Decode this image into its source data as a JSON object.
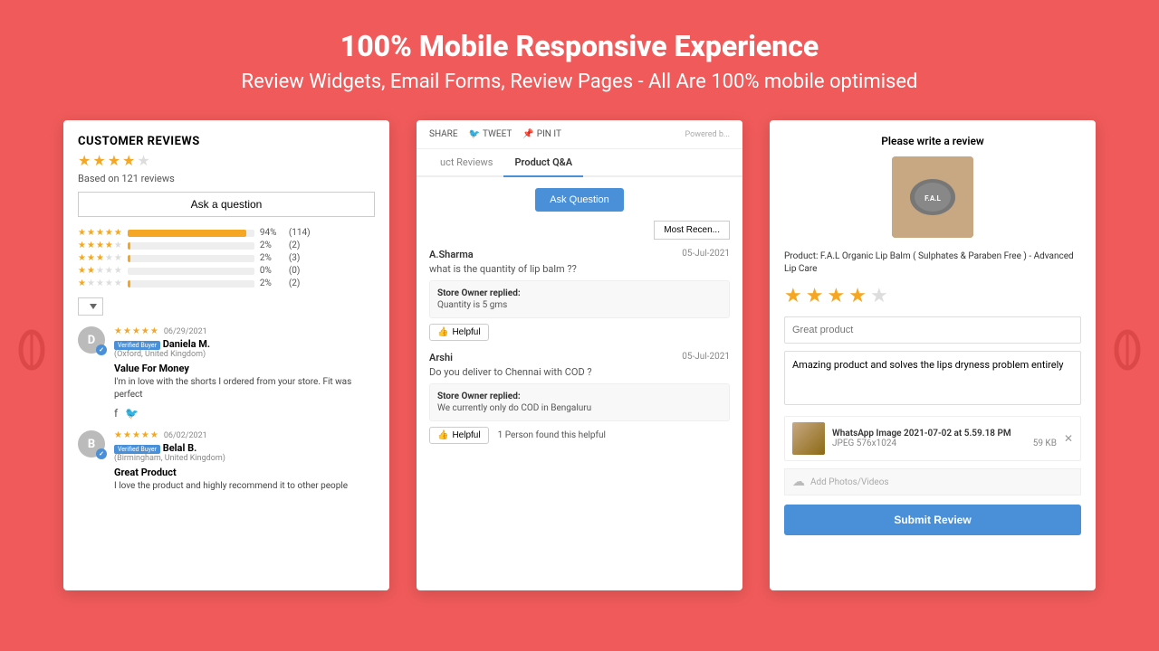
{
  "header": {
    "title": "100% Mobile Responsive Experience",
    "subtitle": "Review Widgets, Email Forms, Review Pages - All Are 100% mobile optimised"
  },
  "card1": {
    "section_title": "CUSTOMER REVIEWS",
    "average_stars": 4,
    "based_on": "Based on 121 reviews",
    "ask_button": "Ask a question",
    "ratings": [
      {
        "stars": 5,
        "pct": "94%",
        "count": "(114)",
        "bar_width": "94"
      },
      {
        "stars": 4,
        "pct": "2%",
        "count": "(2)",
        "bar_width": "2"
      },
      {
        "stars": 3,
        "pct": "2%",
        "count": "(3)",
        "bar_width": "2"
      },
      {
        "stars": 2,
        "pct": "0%",
        "count": "(0)",
        "bar_width": "0"
      },
      {
        "stars": 1,
        "pct": "2%",
        "count": "(2)",
        "bar_width": "2"
      }
    ],
    "reviews": [
      {
        "initial": "D",
        "color": "#bbb",
        "verified": true,
        "verified_label": "Verified Buyer",
        "name": "Daniela M.",
        "location": "(Oxford, United Kingdom)",
        "date": "06/29/2021",
        "stars": 5,
        "title": "Value For Money",
        "text": "I'm in love with the shorts I ordered from your store. Fit was perfect"
      },
      {
        "initial": "B",
        "color": "#bbb",
        "verified": true,
        "verified_label": "Verified Buyer",
        "name": "Belal B.",
        "location": "(Birmingham, United Kingdom)",
        "date": "06/02/2021",
        "stars": 5,
        "title": "Great Product",
        "text": "I love the product and highly recommend it to other people"
      }
    ]
  },
  "card2": {
    "share_label": "SHARE",
    "tweet_label": "TWEET",
    "pin_label": "PIN IT",
    "powered_by": "Powered b...",
    "tab_reviews": "uct Reviews",
    "tab_qa": "Product Q&A",
    "ask_question_btn": "Ask Question",
    "filter_label": "Most Recen...",
    "questions": [
      {
        "user": "A.Sharma",
        "date": "05-Jul-2021",
        "question": "what is the quantity of lip balm ??",
        "reply_label": "Store Owner replied:",
        "reply": "Quantity is 5 gms",
        "helpful_btn": "Helpful",
        "helpful_count": ""
      },
      {
        "user": "Arshi",
        "date": "05-Jul-2021",
        "question": "Do you deliver to Chennai with COD ?",
        "reply_label": "Store Owner replied:",
        "reply": "We currently only do COD in Bengaluru",
        "helpful_btn": "Helpful",
        "helpful_count": "1 Person found this helpful"
      }
    ]
  },
  "card3": {
    "title": "Please write a review",
    "product_label": "Product: F.A.L Organic Lip Balm ( Sulphates & Paraben Free ) - Advanced Lip Care",
    "stars_filled": 4,
    "stars_empty": 1,
    "review_title_placeholder": "Great product",
    "review_body_value": "Amazing product and solves the lips dryness problem entirely",
    "attachment_name": "WhatsApp Image 2021-07-02 at 5.59.18 PM",
    "attachment_type": "JPEG  576x1024",
    "attachment_size": "59 KB",
    "add_photos_label": "Add Photos/Videos",
    "submit_button": "Submit Review"
  }
}
